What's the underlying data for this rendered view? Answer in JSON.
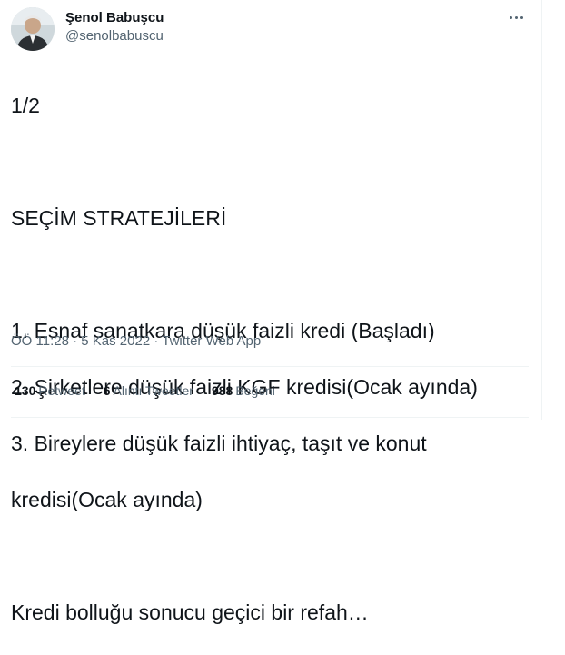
{
  "author": {
    "display_name": "Şenol Babuşcu",
    "handle": "@senolbabuscu"
  },
  "tweet": {
    "lines": [
      "1/2",
      "",
      "SEÇİM STRATEJİLERİ",
      "",
      "1. Esnaf sanatkara düşük faizli kredi (Başladı)",
      "2. Şirketlere düşük faizli KGF kredisi(Ocak ayında)",
      "3. Bireylere düşük faizli ihtiyaç, taşıt ve konut",
      "kredisi(Ocak ayında)",
      "",
      "Kredi bolluğu sonucu geçici bir refah…"
    ]
  },
  "meta": {
    "time": "ÖÖ 11:28",
    "separator1": " · ",
    "date": "5 Kas 2022",
    "separator2": " · ",
    "app": "Twitter Web App"
  },
  "stats": {
    "retweets_count": "130",
    "retweets_label": "Retweet",
    "quotes_count": "6",
    "quotes_label": "Alıntı Tweetler",
    "likes_count": "988",
    "likes_label": "Beğeni"
  },
  "icons": {
    "more": "more-horizontal-icon"
  }
}
